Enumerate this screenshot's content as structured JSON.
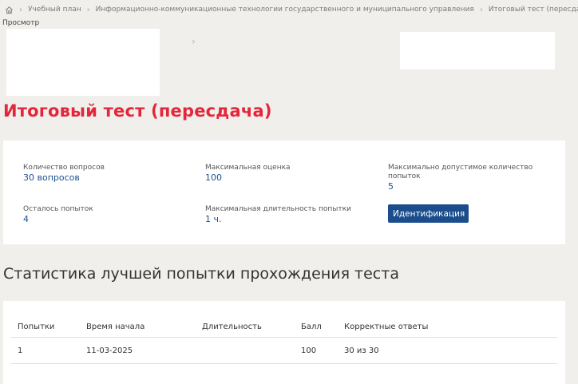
{
  "breadcrumb": {
    "items": [
      "Учебный план",
      "Информационно-коммуникационные технологии государственного и муниципального управления",
      "Итоговый тест (пересдача)"
    ]
  },
  "subtitle": "Просмотр",
  "title": "Итоговый тест (пересдача)",
  "info": {
    "questions_label": "Количество вопросов",
    "questions_value": "30 вопросов",
    "max_grade_label": "Максимальная оценка",
    "max_grade_value": "100",
    "max_attempts_label": "Максимально допустимое количество попыток",
    "max_attempts_value": "5",
    "attempts_left_label": "Осталось попыток",
    "attempts_left_value": "4",
    "max_duration_label": "Максимальная длительность попытки",
    "max_duration_value": "1 ч.",
    "ident_button": "Идентификация"
  },
  "stats": {
    "title": "Статистика лучшей попытки прохождения теста",
    "headers": [
      "Попытки",
      "Время начала",
      "Длительность",
      "Балл",
      "Корректные ответы"
    ],
    "rows": [
      [
        "1",
        "11-03-2025",
        "",
        "100",
        "30 из 30"
      ]
    ]
  },
  "colors": {
    "accent_red": "#e3263a",
    "link_blue": "#1d4f91",
    "button_blue": "#1b4d8c",
    "page_bg": "#f1efec"
  },
  "icons": [
    "home-icon",
    "chevron-right-icon"
  ]
}
